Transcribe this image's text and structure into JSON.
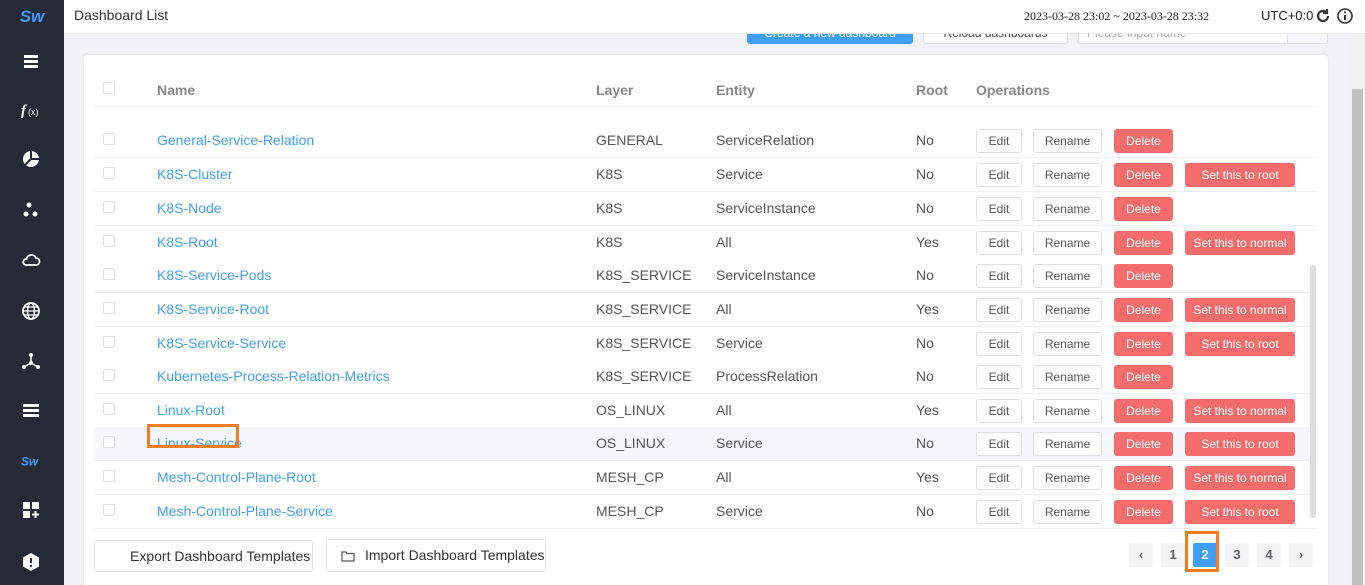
{
  "header": {
    "title": "Dashboard List",
    "time_range": "2023-03-28 23:02 ~ 2023-03-28 23:32",
    "timezone": "UTC+0:0"
  },
  "toolbar": {
    "create_label": "Create a new dashboard",
    "reload_label": "Reload dashboards",
    "search_placeholder": "Please input name"
  },
  "table": {
    "columns": [
      "Name",
      "Layer",
      "Entity",
      "Root",
      "Operations"
    ],
    "edit_label": "Edit",
    "rename_label": "Rename",
    "delete_label": "Delete",
    "rows": [
      {
        "name": "General-Service-Relation",
        "layer": "GENERAL",
        "entity": "ServiceRelation",
        "root": "No",
        "root_action": ""
      },
      {
        "name": "K8S-Cluster",
        "layer": "K8S",
        "entity": "Service",
        "root": "No",
        "root_action": "Set this to root"
      },
      {
        "name": "K8S-Node",
        "layer": "K8S",
        "entity": "ServiceInstance",
        "root": "No",
        "root_action": ""
      },
      {
        "name": "K8S-Root",
        "layer": "K8S",
        "entity": "All",
        "root": "Yes",
        "root_action": "Set this to normal"
      },
      {
        "name": "K8S-Service-Pods",
        "layer": "K8S_SERVICE",
        "entity": "ServiceInstance",
        "root": "No",
        "root_action": ""
      },
      {
        "name": "K8S-Service-Root",
        "layer": "K8S_SERVICE",
        "entity": "All",
        "root": "Yes",
        "root_action": "Set this to normal"
      },
      {
        "name": "K8S-Service-Service",
        "layer": "K8S_SERVICE",
        "entity": "Service",
        "root": "No",
        "root_action": "Set this to root"
      },
      {
        "name": "Kubernetes-Process-Relation-Metrics",
        "layer": "K8S_SERVICE",
        "entity": "ProcessRelation",
        "root": "No",
        "root_action": ""
      },
      {
        "name": "Linux-Root",
        "layer": "OS_LINUX",
        "entity": "All",
        "root": "Yes",
        "root_action": "Set this to normal"
      },
      {
        "name": "Linux-Service",
        "layer": "OS_LINUX",
        "entity": "Service",
        "root": "No",
        "root_action": "Set this to root"
      },
      {
        "name": "Mesh-Control-Plane-Root",
        "layer": "MESH_CP",
        "entity": "All",
        "root": "Yes",
        "root_action": "Set this to normal"
      },
      {
        "name": "Mesh-Control-Plane-Service",
        "layer": "MESH_CP",
        "entity": "Service",
        "root": "No",
        "root_action": "Set this to root"
      }
    ]
  },
  "footer": {
    "export_label": "Export Dashboard Templates",
    "import_label": "Import Dashboard Templates"
  },
  "pagination": {
    "prev_icon": "‹",
    "next_icon": "›",
    "pages": [
      "1",
      "2",
      "3",
      "4"
    ],
    "current": "2"
  },
  "sidebar": {
    "logo": "Sw",
    "icons": [
      "layers-icon",
      "function-icon",
      "pie-chart-icon",
      "cluster-icon",
      "cloud-icon",
      "globe-icon",
      "network-icon",
      "database-icon",
      "skywalking-icon",
      "dashboard-add-icon",
      "settings-hex-icon"
    ]
  },
  "colors": {
    "sidebar_bg": "#252a36",
    "accent": "#409eff",
    "danger": "#f56c6c",
    "highlight": "#f57c1f"
  }
}
